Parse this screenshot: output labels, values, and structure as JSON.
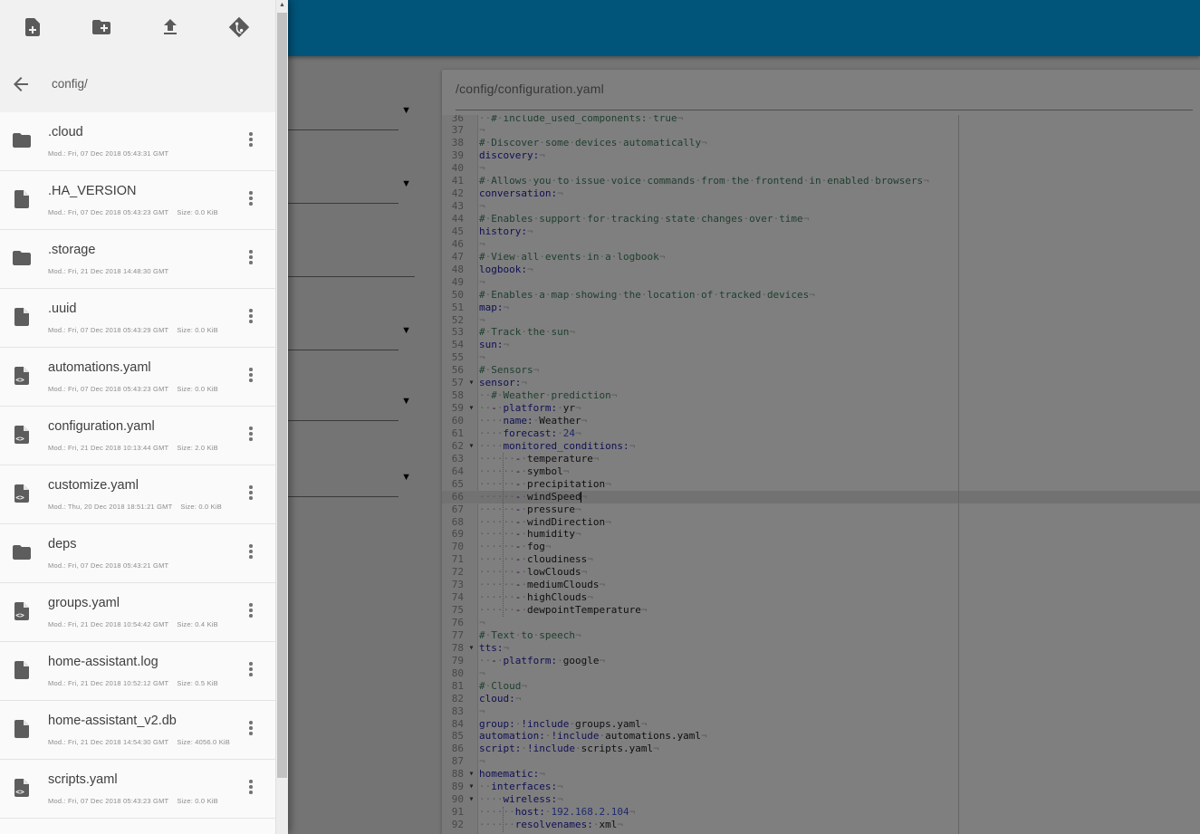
{
  "colors": {
    "topbar": "#03a9f4",
    "main_bg": "#e9e9e9",
    "editor_bg": "#ffffff",
    "drawer_bg": "#fafafa",
    "gutter": "#f2f2f2",
    "activeline": "#e4e4e4",
    "ruler": "#c9c9c9",
    "comment": "#3f7f5f",
    "key": "#2222aa",
    "meta": "#770088",
    "number": "#3d55d8",
    "text": "#1d1d1d",
    "whitespace": "#b5b5b5",
    "linenum": "#8f8f8f",
    "scrim": "rgba(0,0,0,0.5)"
  },
  "icons": {
    "dropdown_arrow": "▼",
    "scroll_up_arrow": "▲",
    "fold_arrow": "▾",
    "eol_mark": "¬",
    "space_dot": "·"
  },
  "drawer": {
    "breadcrumb": "config/",
    "toolbar": [
      {
        "name": "new-file"
      },
      {
        "name": "new-folder"
      },
      {
        "name": "upload"
      },
      {
        "name": "git"
      }
    ],
    "files": [
      {
        "name": ".cloud",
        "kind": "folder",
        "mod": "Mod.: Fri, 07 Dec 2018 05:43:31 GMT",
        "size": null
      },
      {
        "name": ".HA_VERSION",
        "kind": "file",
        "mod": "Mod.: Fri, 07 Dec 2018 05:43:23 GMT",
        "size": "Size: 0.0 KiB"
      },
      {
        "name": ".storage",
        "kind": "folder",
        "mod": "Mod.: Fri, 21 Dec 2018 14:48:30 GMT",
        "size": null
      },
      {
        "name": ".uuid",
        "kind": "file",
        "mod": "Mod.: Fri, 07 Dec 2018 05:43:29 GMT",
        "size": "Size: 0.0 KiB"
      },
      {
        "name": "automations.yaml",
        "kind": "code",
        "mod": "Mod.: Fri, 07 Dec 2018 05:43:23 GMT",
        "size": "Size: 0.0 KiB"
      },
      {
        "name": "configuration.yaml",
        "kind": "code",
        "mod": "Mod.: Fri, 21 Dec 2018 10:13:44 GMT",
        "size": "Size: 2.0 KiB"
      },
      {
        "name": "customize.yaml",
        "kind": "code",
        "mod": "Mod.: Thu, 20 Dec 2018 18:51:21 GMT",
        "size": "Size: 0.0 KiB"
      },
      {
        "name": "deps",
        "kind": "folder",
        "mod": "Mod.: Fri, 07 Dec 2018 05:43:21 GMT",
        "size": null
      },
      {
        "name": "groups.yaml",
        "kind": "code",
        "mod": "Mod.: Fri, 21 Dec 2018 10:54:42 GMT",
        "size": "Size: 0.4 KiB"
      },
      {
        "name": "home-assistant.log",
        "kind": "file",
        "mod": "Mod.: Fri, 21 Dec 2018 10:52:12 GMT",
        "size": "Size: 0.5 KiB"
      },
      {
        "name": "home-assistant_v2.db",
        "kind": "file",
        "mod": "Mod.: Fri, 21 Dec 2018 14:54:30 GMT",
        "size": "Size: 4056.0 KiB"
      },
      {
        "name": "scripts.yaml",
        "kind": "code",
        "mod": "Mod.: Fri, 07 Dec 2018 05:43:23 GMT",
        "size": "Size: 0.0 KiB"
      }
    ]
  },
  "main": {
    "filename": "/config/configuration.yaml"
  },
  "editor": {
    "first_line": 36,
    "active_line": 66,
    "cursor": {
      "line": 66,
      "ch": 17
    },
    "fold_lines": [
      57,
      59,
      62,
      78,
      88,
      89,
      90
    ],
    "guides": [
      {
        "from": 63,
        "to": 75,
        "col": 4
      },
      {
        "from": 91,
        "to": 92,
        "col": 4
      }
    ],
    "ruler_col": 80,
    "lines": [
      {
        "n": 36,
        "segs": [
          [
            "t",
            "  "
          ],
          [
            "c",
            "# include_used_components: true"
          ]
        ]
      },
      {
        "n": 37,
        "segs": []
      },
      {
        "n": 38,
        "segs": [
          [
            "c",
            "# Discover some devices automatically"
          ]
        ]
      },
      {
        "n": 39,
        "segs": [
          [
            "k",
            "discovery:"
          ]
        ]
      },
      {
        "n": 40,
        "segs": []
      },
      {
        "n": 41,
        "segs": [
          [
            "c",
            "# Allows you to issue voice commands from the frontend in enabled browsers"
          ]
        ]
      },
      {
        "n": 42,
        "segs": [
          [
            "k",
            "conversation:"
          ]
        ]
      },
      {
        "n": 43,
        "segs": []
      },
      {
        "n": 44,
        "segs": [
          [
            "c",
            "# Enables support for tracking state changes over time"
          ]
        ]
      },
      {
        "n": 45,
        "segs": [
          [
            "k",
            "history:"
          ]
        ]
      },
      {
        "n": 46,
        "segs": []
      },
      {
        "n": 47,
        "segs": [
          [
            "c",
            "# View all events in a logbook"
          ]
        ]
      },
      {
        "n": 48,
        "segs": [
          [
            "k",
            "logbook:"
          ]
        ]
      },
      {
        "n": 49,
        "segs": []
      },
      {
        "n": 50,
        "segs": [
          [
            "c",
            "# Enables a map showing the location of tracked devices"
          ]
        ]
      },
      {
        "n": 51,
        "segs": [
          [
            "k",
            "map:"
          ]
        ]
      },
      {
        "n": 52,
        "segs": []
      },
      {
        "n": 53,
        "segs": [
          [
            "c",
            "# Track the sun"
          ]
        ]
      },
      {
        "n": 54,
        "segs": [
          [
            "k",
            "sun:"
          ]
        ]
      },
      {
        "n": 55,
        "segs": []
      },
      {
        "n": 56,
        "segs": [
          [
            "c",
            "# Sensors"
          ]
        ]
      },
      {
        "n": 57,
        "segs": [
          [
            "k",
            "sensor:"
          ]
        ]
      },
      {
        "n": 58,
        "segs": [
          [
            "t",
            "  "
          ],
          [
            "c",
            "# Weather prediction"
          ]
        ]
      },
      {
        "n": 59,
        "segs": [
          [
            "t",
            "  "
          ],
          [
            "m",
            "- "
          ],
          [
            "k",
            "platform:"
          ],
          [
            "t",
            " yr"
          ]
        ]
      },
      {
        "n": 60,
        "segs": [
          [
            "t",
            "    "
          ],
          [
            "k",
            "name:"
          ],
          [
            "t",
            " Weather"
          ]
        ]
      },
      {
        "n": 61,
        "segs": [
          [
            "t",
            "    "
          ],
          [
            "k",
            "forecast:"
          ],
          [
            "t",
            " "
          ],
          [
            "n",
            "24"
          ]
        ]
      },
      {
        "n": 62,
        "segs": [
          [
            "t",
            "    "
          ],
          [
            "k",
            "monitored_conditions:"
          ]
        ]
      },
      {
        "n": 63,
        "segs": [
          [
            "t",
            "      "
          ],
          [
            "m",
            "- "
          ],
          [
            "t",
            "temperature"
          ]
        ]
      },
      {
        "n": 64,
        "segs": [
          [
            "t",
            "      "
          ],
          [
            "m",
            "- "
          ],
          [
            "t",
            "symbol"
          ]
        ]
      },
      {
        "n": 65,
        "segs": [
          [
            "t",
            "      "
          ],
          [
            "m",
            "- "
          ],
          [
            "t",
            "precipitation"
          ]
        ]
      },
      {
        "n": 66,
        "segs": [
          [
            "t",
            "      "
          ],
          [
            "m",
            "- "
          ],
          [
            "t",
            "windSpeed"
          ]
        ]
      },
      {
        "n": 67,
        "segs": [
          [
            "t",
            "      "
          ],
          [
            "m",
            "- "
          ],
          [
            "t",
            "pressure"
          ]
        ]
      },
      {
        "n": 68,
        "segs": [
          [
            "t",
            "      "
          ],
          [
            "m",
            "- "
          ],
          [
            "t",
            "windDirection"
          ]
        ]
      },
      {
        "n": 69,
        "segs": [
          [
            "t",
            "      "
          ],
          [
            "m",
            "- "
          ],
          [
            "t",
            "humidity"
          ]
        ]
      },
      {
        "n": 70,
        "segs": [
          [
            "t",
            "      "
          ],
          [
            "m",
            "- "
          ],
          [
            "t",
            "fog"
          ]
        ]
      },
      {
        "n": 71,
        "segs": [
          [
            "t",
            "      "
          ],
          [
            "m",
            "- "
          ],
          [
            "t",
            "cloudiness"
          ]
        ]
      },
      {
        "n": 72,
        "segs": [
          [
            "t",
            "      "
          ],
          [
            "m",
            "- "
          ],
          [
            "t",
            "lowClouds"
          ]
        ]
      },
      {
        "n": 73,
        "segs": [
          [
            "t",
            "      "
          ],
          [
            "m",
            "- "
          ],
          [
            "t",
            "mediumClouds"
          ]
        ]
      },
      {
        "n": 74,
        "segs": [
          [
            "t",
            "      "
          ],
          [
            "m",
            "- "
          ],
          [
            "t",
            "highClouds"
          ]
        ]
      },
      {
        "n": 75,
        "segs": [
          [
            "t",
            "      "
          ],
          [
            "m",
            "- "
          ],
          [
            "t",
            "dewpointTemperature"
          ]
        ]
      },
      {
        "n": 76,
        "segs": []
      },
      {
        "n": 77,
        "segs": [
          [
            "c",
            "# Text to speech"
          ]
        ]
      },
      {
        "n": 78,
        "segs": [
          [
            "k",
            "tts:"
          ]
        ]
      },
      {
        "n": 79,
        "segs": [
          [
            "t",
            "  "
          ],
          [
            "m",
            "- "
          ],
          [
            "k",
            "platform:"
          ],
          [
            "t",
            " google"
          ]
        ]
      },
      {
        "n": 80,
        "segs": []
      },
      {
        "n": 81,
        "segs": [
          [
            "c",
            "# Cloud"
          ]
        ]
      },
      {
        "n": 82,
        "segs": [
          [
            "k",
            "cloud:"
          ]
        ]
      },
      {
        "n": 83,
        "segs": []
      },
      {
        "n": 84,
        "segs": [
          [
            "k",
            "group:"
          ],
          [
            "t",
            " "
          ],
          [
            "k",
            "!include"
          ],
          [
            "t",
            " groups.yaml"
          ]
        ]
      },
      {
        "n": 85,
        "segs": [
          [
            "k",
            "automation:"
          ],
          [
            "t",
            " "
          ],
          [
            "k",
            "!include"
          ],
          [
            "t",
            " automations.yaml"
          ]
        ]
      },
      {
        "n": 86,
        "segs": [
          [
            "k",
            "script:"
          ],
          [
            "t",
            " "
          ],
          [
            "k",
            "!include"
          ],
          [
            "t",
            " scripts.yaml"
          ]
        ]
      },
      {
        "n": 87,
        "segs": []
      },
      {
        "n": 88,
        "segs": [
          [
            "k",
            "homematic:"
          ]
        ]
      },
      {
        "n": 89,
        "segs": [
          [
            "t",
            "  "
          ],
          [
            "k",
            "interfaces:"
          ]
        ]
      },
      {
        "n": 90,
        "segs": [
          [
            "t",
            "    "
          ],
          [
            "k",
            "wireless:"
          ]
        ]
      },
      {
        "n": 91,
        "segs": [
          [
            "t",
            "      "
          ],
          [
            "k",
            "host:"
          ],
          [
            "t",
            " "
          ],
          [
            "n",
            "192.168.2.104"
          ]
        ]
      },
      {
        "n": 92,
        "segs": [
          [
            "t",
            "      "
          ],
          [
            "k",
            "resolvenames:"
          ],
          [
            "t",
            " xml"
          ]
        ]
      }
    ]
  }
}
